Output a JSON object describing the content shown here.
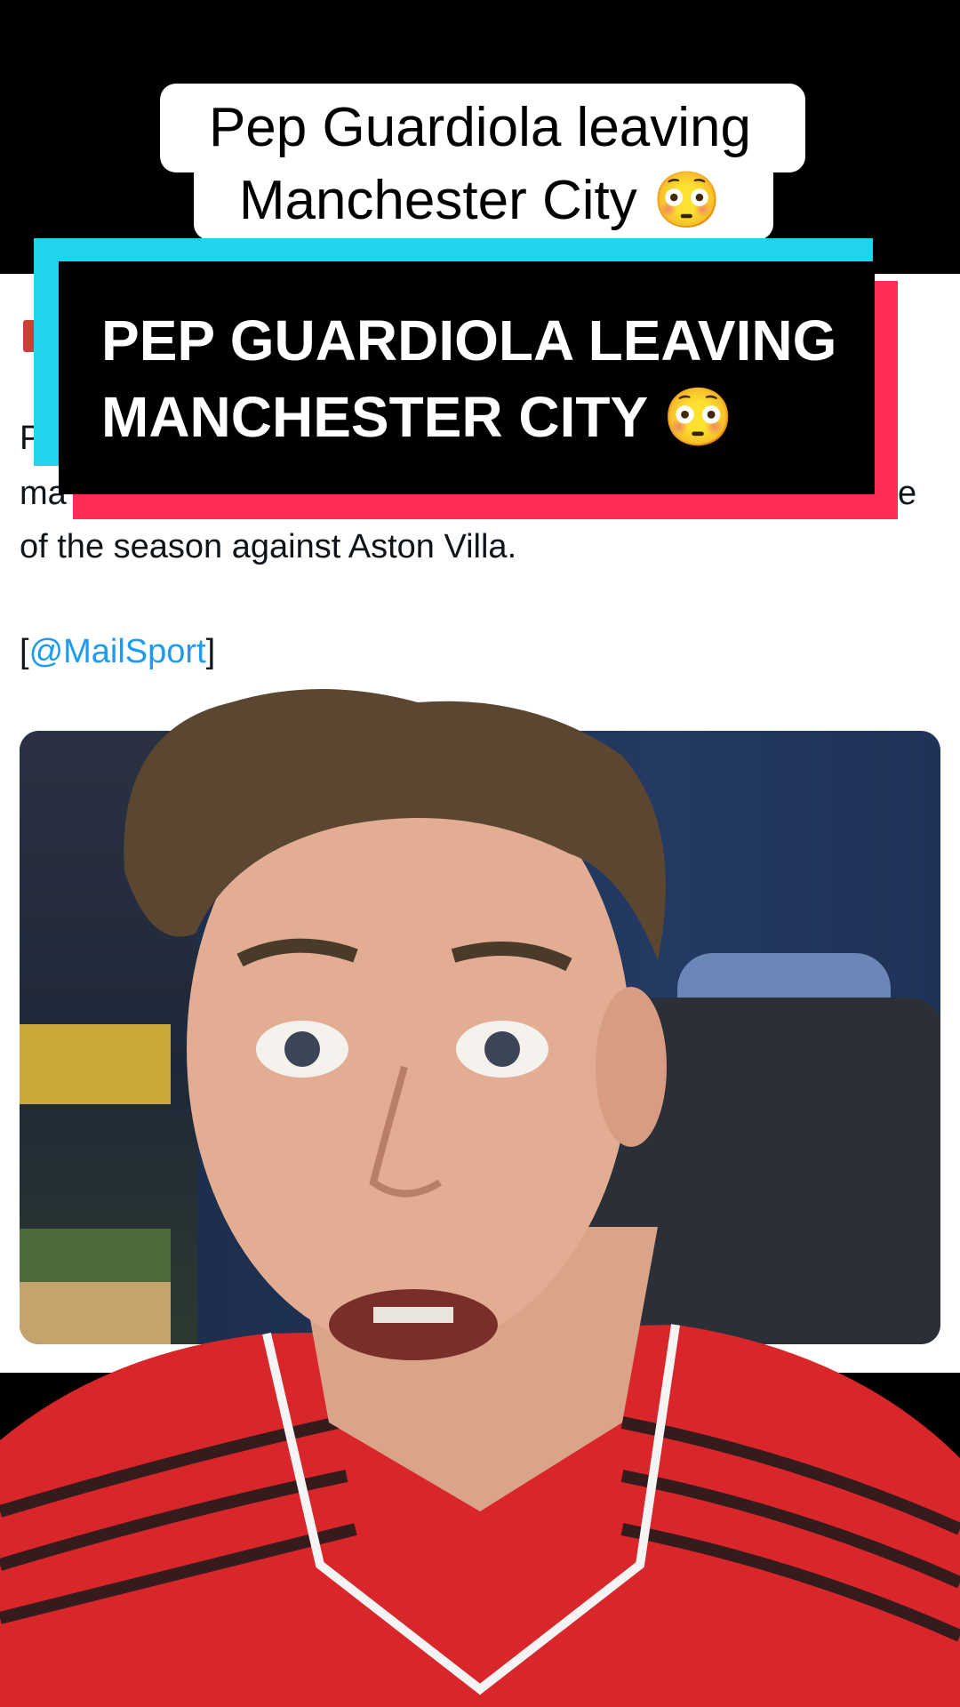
{
  "caption": {
    "line1": "Pep Guardiola leaving",
    "line2": "Manchester City 😳"
  },
  "banner": {
    "line1": "PEP GUARDIOLA LEAVING",
    "line2": "MANCHESTER CITY 😳"
  },
  "tweet": {
    "line1_clip": "P",
    "line2_clip": "ma",
    "line2_end": "e",
    "line3": "of the season against Aston Villa.",
    "source_open": "[",
    "source_mention": "@MailSport",
    "source_close": "]"
  },
  "colors": {
    "banner_cyan": "#22d3ee",
    "banner_red": "#ff2d55",
    "mention_blue": "#1d9bf0"
  }
}
